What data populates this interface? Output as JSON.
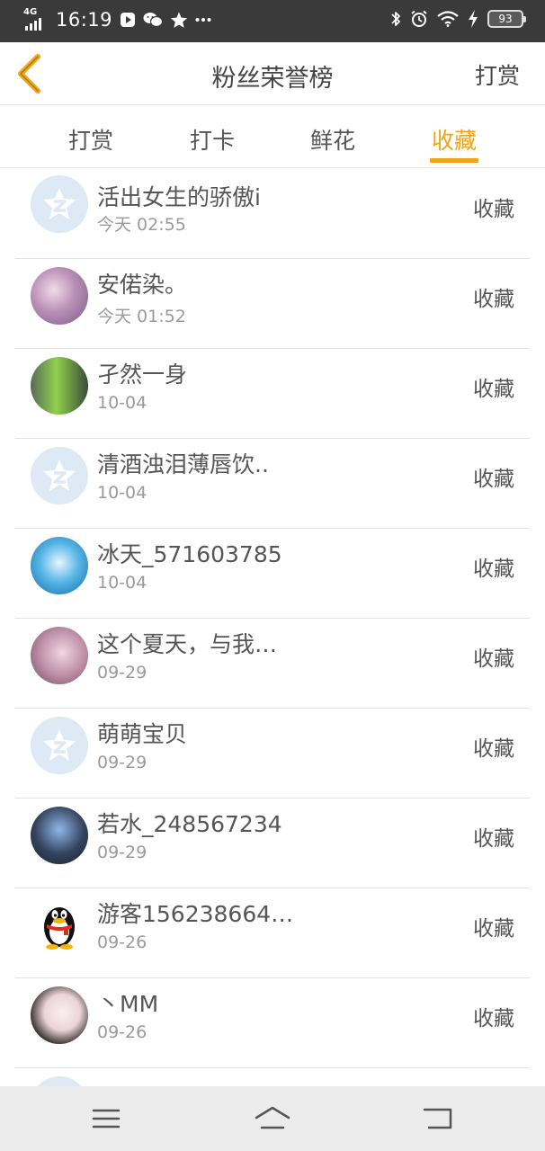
{
  "status_bar": {
    "network": "4G",
    "time": "16:19",
    "battery": "93",
    "icons": [
      "signal-icon",
      "notification-icon",
      "wechat-icon",
      "star-icon",
      "more-icon",
      "bluetooth-icon",
      "alarm-icon",
      "wifi-icon",
      "charging-icon",
      "battery-icon"
    ]
  },
  "header": {
    "title": "粉丝荣誉榜",
    "right_action": "打赏",
    "back_icon": "back-chevron-icon"
  },
  "tabs": [
    {
      "label": "打赏",
      "active": false
    },
    {
      "label": "打卡",
      "active": false
    },
    {
      "label": "鲜花",
      "active": false
    },
    {
      "label": "收藏",
      "active": true
    }
  ],
  "accent_color": "#f0a416",
  "list": [
    {
      "name": "活出女生的骄傲i",
      "date": "今天 02:55",
      "action": "收藏"
    },
    {
      "name": "安偌染。",
      "date": "今天 01:52",
      "action": "收藏"
    },
    {
      "name": "孑然一身",
      "date": "10-04",
      "action": "收藏"
    },
    {
      "name": "清酒浊泪薄唇饮..",
      "date": "10-04",
      "action": "收藏"
    },
    {
      "name": "冰天_571603785",
      "date": "10-04",
      "action": "收藏"
    },
    {
      "name": "这个夏天，与我…",
      "date": "09-29",
      "action": "收藏"
    },
    {
      "name": "萌萌宝贝",
      "date": "09-29",
      "action": "收藏"
    },
    {
      "name": "若水_248567234",
      "date": "09-29",
      "action": "收藏"
    },
    {
      "name": "游客156238664…",
      "date": "09-26",
      "action": "收藏"
    },
    {
      "name": "丶MM",
      "date": "09-26",
      "action": "收藏"
    }
  ],
  "nav_bar": {
    "icons": [
      "menu-icon",
      "home-icon",
      "back-icon"
    ]
  }
}
